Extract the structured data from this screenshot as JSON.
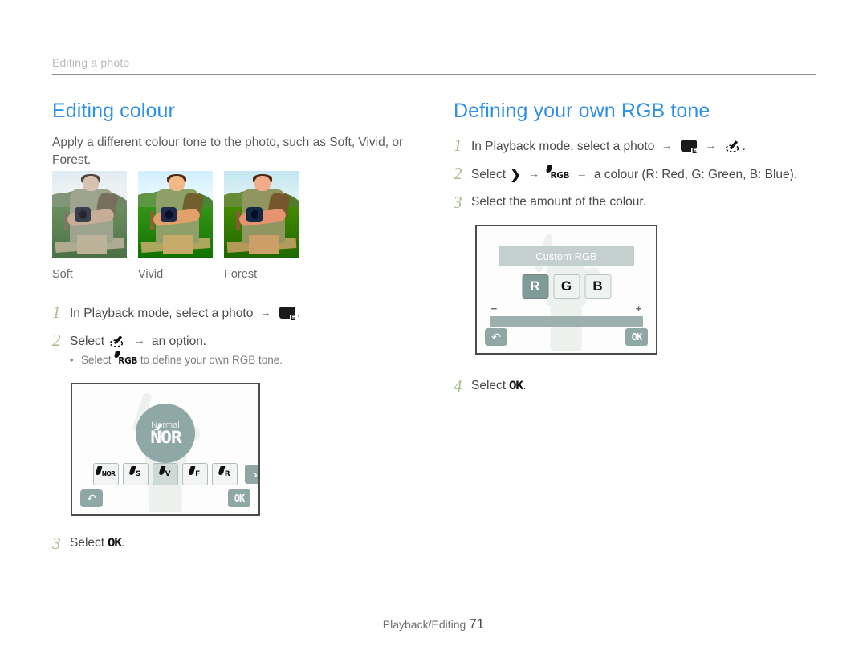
{
  "breadcrumb": "Editing a photo",
  "left": {
    "title": "Editing colour",
    "lead": "Apply a different colour tone to the photo, such as Soft, Vivid, or Forest.",
    "thumbnails": [
      {
        "label": "Soft"
      },
      {
        "label": "Vivid"
      },
      {
        "label": "Forest"
      }
    ],
    "steps": [
      {
        "num": "1",
        "text_before": "In Playback mode, select a photo",
        "icons": [
          "arrow",
          "edit-mode"
        ],
        "text_after": "."
      },
      {
        "num": "2",
        "text_before": "Select",
        "icons": [
          "brush",
          "arrow"
        ],
        "text_after": "an option."
      }
    ],
    "substep": {
      "bullet": "•",
      "text_before": "Select",
      "text_after": "to define your own RGB tone.",
      "icon_label": "RGB"
    },
    "final_step": {
      "num": "3",
      "text_before": "Select",
      "ok": "OK",
      "text_after": "."
    },
    "screen": {
      "mode_label": "Normal",
      "mode_code": "NOR",
      "options": [
        "NOR",
        "S",
        "V",
        "F",
        "R"
      ],
      "selected_option": "V",
      "next_arrow": "›",
      "back_label": "↶",
      "ok_label": "OK"
    }
  },
  "right": {
    "title": "Defining your own RGB tone",
    "steps": [
      {
        "num": "1",
        "text_before": "In Playback mode, select a photo",
        "text_after": "."
      },
      {
        "num": "2",
        "text_before": "Select",
        "text_after": "a colour (R: Red, G: Green, B: Blue)."
      },
      {
        "num": "3",
        "text": "Select the amount of the colour."
      }
    ],
    "final_step": {
      "num": "4",
      "text_before": "Select",
      "ok": "OK",
      "text_after": "."
    },
    "screen": {
      "title": "Custom RGB",
      "channels": [
        "R",
        "G",
        "B"
      ],
      "selected_channel": "R",
      "minus": "−",
      "plus": "+",
      "back_label": "↶",
      "ok_label": "OK"
    }
  },
  "footer": {
    "section": "Playback/Editing",
    "page": "71"
  },
  "colors": {
    "heading_blue": "#2f90e8",
    "step_number_green": "#a9bd8d",
    "ui_teal": "#8fa8a5",
    "body_text": "#4a4a4a"
  }
}
